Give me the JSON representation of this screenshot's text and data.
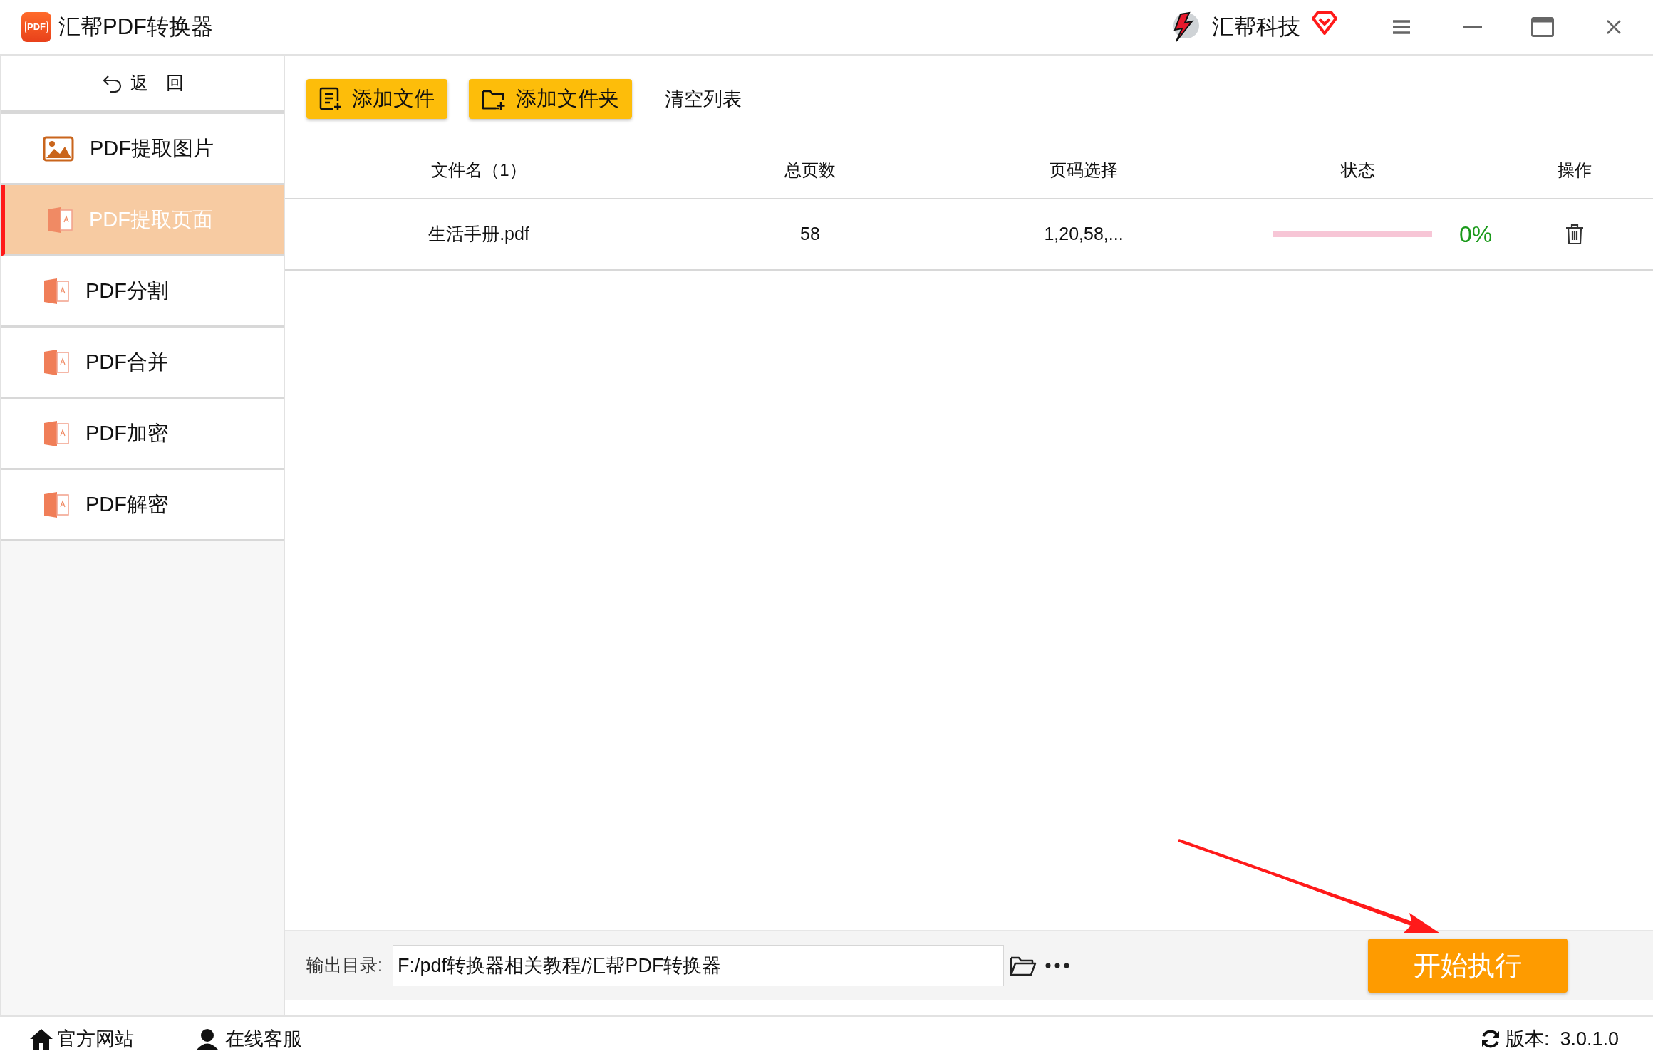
{
  "window": {
    "title": "汇帮PDF转换器",
    "logo_text": "PDF",
    "brand": "汇帮科技"
  },
  "sidebar": {
    "back": "返　回",
    "items": [
      {
        "label": "PDF提取图片",
        "kind": "image",
        "selected": false
      },
      {
        "label": "PDF提取页面",
        "kind": "pdf",
        "selected": true
      },
      {
        "label": "PDF分割",
        "kind": "pdf",
        "selected": false
      },
      {
        "label": "PDF合并",
        "kind": "pdf",
        "selected": false
      },
      {
        "label": "PDF加密",
        "kind": "pdf",
        "selected": false
      },
      {
        "label": "PDF解密",
        "kind": "pdf",
        "selected": false
      }
    ]
  },
  "toolbar": [
    {
      "label": "添加文件",
      "kind": "file"
    },
    {
      "label": "添加文件夹",
      "kind": "folder"
    },
    {
      "label": "清空列表",
      "kind": "plain"
    }
  ],
  "table": {
    "columns": [
      "文件名（1）",
      "总页数",
      "页码选择",
      "状态",
      "操作"
    ],
    "rows": [
      {
        "name": "生活手册.pdf",
        "pages": "58",
        "selection": "1,20,58,...",
        "level": 0,
        "progress": "0%"
      }
    ]
  },
  "output": {
    "label": "输出目录:",
    "path": "F:/pdf转换器相关教程/汇帮PDF转换器",
    "start": "开始执行"
  },
  "footer": {
    "website": "官方网站",
    "support": "在线客服",
    "version": "版本:  3.0.1.0"
  }
}
